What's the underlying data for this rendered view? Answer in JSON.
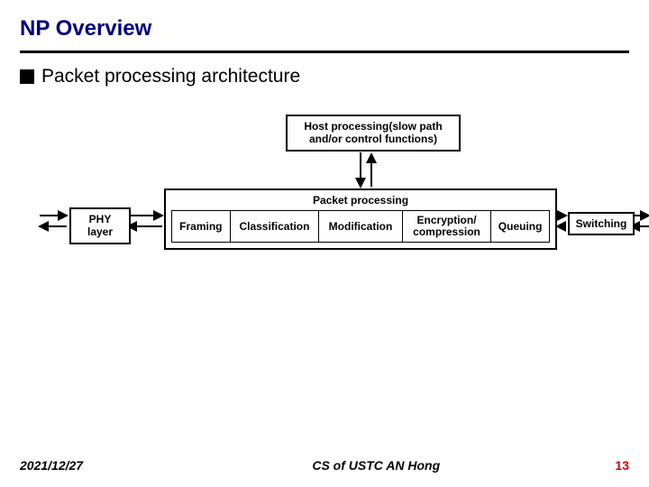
{
  "title": "NP Overview",
  "subtitle": "Packet processing architecture",
  "host_box": {
    "line1": "Host processing(slow path",
    "line2": "and/or control functions)"
  },
  "packet_label": "Packet processing",
  "stages": {
    "framing": "Framing",
    "classification": "Classification",
    "modification": "Modification",
    "encryption_l1": "Encryption/",
    "encryption_l2": "compression",
    "queuing": "Queuing"
  },
  "phy": {
    "line1": "PHY",
    "line2": "layer"
  },
  "switching": "Switching",
  "footer": {
    "date": "2021/12/27",
    "center": "CS of USTC AN Hong",
    "page": "13"
  }
}
